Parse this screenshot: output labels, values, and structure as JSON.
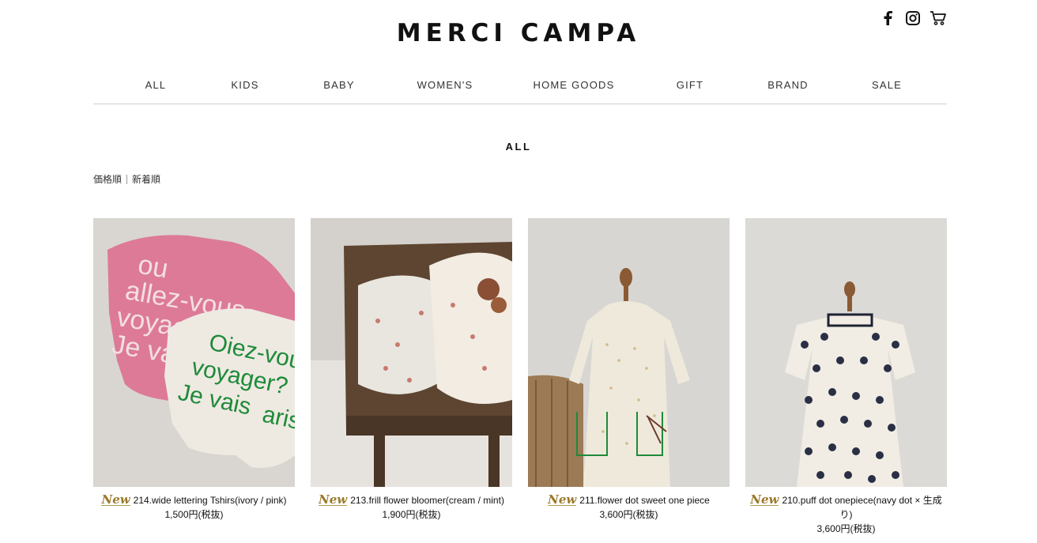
{
  "header": {
    "logo": "MERCI CAMPA",
    "icons": [
      "facebook-icon",
      "instagram-icon",
      "cart-icon"
    ]
  },
  "nav": {
    "items": [
      "ALL",
      "KIDS",
      "BABY",
      "WOMEN'S",
      "HOME GOODS",
      "GIFT",
      "BRAND",
      "SALE"
    ]
  },
  "page": {
    "title": "ALL"
  },
  "sort": {
    "price": "価格順",
    "newest": "新着順"
  },
  "products": [
    {
      "badge": "New",
      "name": "214.wide lettering Tshirs(ivory / pink)",
      "price": "1,500円(税抜)"
    },
    {
      "badge": "New",
      "name": "213.frill flower bloomer(cream / mint)",
      "price": "1,900円(税抜)"
    },
    {
      "badge": "New",
      "name": "211.flower dot sweet one piece",
      "price": "3,600円(税抜)"
    },
    {
      "badge": "New",
      "name": "210.puff dot onepiece(navy dot × 生成り)",
      "price": "3,600円(税抜)"
    }
  ],
  "image_text": {
    "pink_shirt": [
      "ou",
      "allez-vous",
      "voyager?",
      "Je vais"
    ],
    "white_shirt": [
      "Oiez-vou",
      "voyager?",
      "Je vais",
      "aris"
    ]
  },
  "colors": {
    "accent_gold": "#9a7a2a",
    "lettering_green": "#1f8a3a",
    "shirt_pink": "#dd7a98"
  }
}
